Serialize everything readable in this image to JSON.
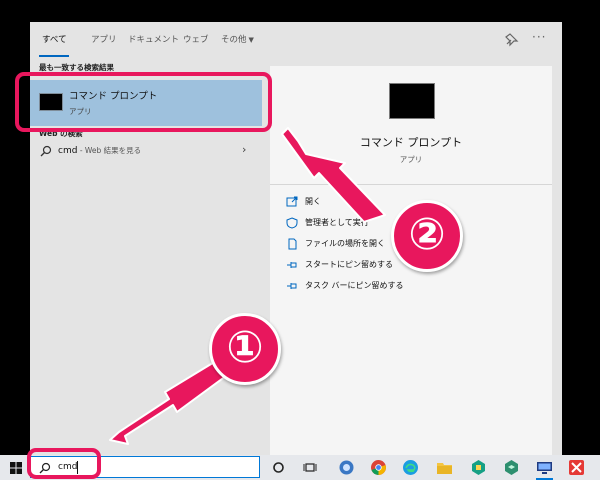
{
  "tabs": [
    {
      "label": "すべて"
    },
    {
      "label": "アプリ"
    },
    {
      "label": "ドキュメント"
    },
    {
      "label": "ウェブ"
    },
    {
      "label": "その他"
    }
  ],
  "left": {
    "best_match_header": "最も一致する検索結果",
    "best_match": {
      "title": "コマンド プロンプト",
      "subtitle": "アプリ"
    },
    "web_header": "Web の検索",
    "web_result": {
      "query": "cmd",
      "desc": " - Web 結果を見る"
    }
  },
  "right": {
    "title": "コマンド プロンプト",
    "subtitle": "アプリ",
    "actions": [
      {
        "label": "開く",
        "icon": "open-icon"
      },
      {
        "label": "管理者として実行",
        "icon": "shield-icon"
      },
      {
        "label": "ファイルの場所を開く",
        "icon": "file-location-icon"
      },
      {
        "label": "スタートにピン留めする",
        "icon": "pin-icon"
      },
      {
        "label": "タスク バーにピン留めする",
        "icon": "pin-icon"
      }
    ]
  },
  "taskbar": {
    "search_value": "cmd",
    "icons": [
      "start-icon",
      "cortana-icon",
      "task-view-icon",
      "browser-icon",
      "chrome-icon",
      "edge-icon",
      "file-explorer-icon",
      "store-icon",
      "app-icon",
      "remote-desktop-icon",
      "xmind-icon"
    ]
  },
  "annotations": {
    "step1": "①",
    "step2": "②",
    "accent_color": "#e8175d"
  }
}
